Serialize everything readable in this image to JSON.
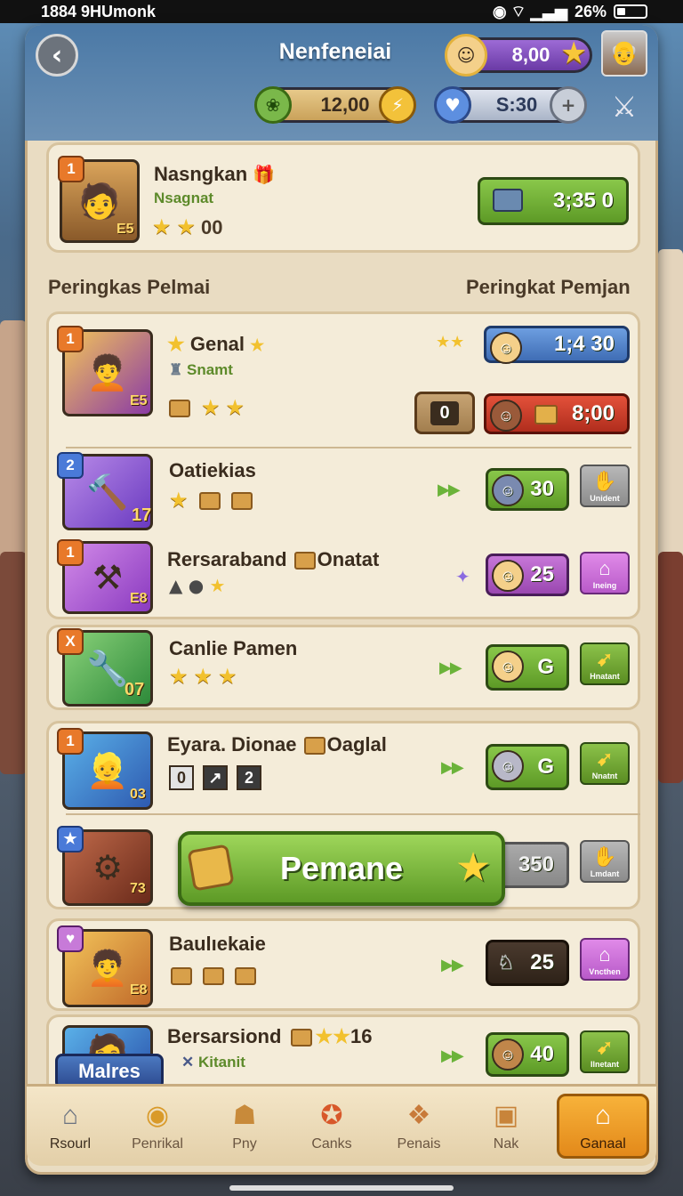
{
  "status": {
    "time": "1884 9HUmonk",
    "battery": "26%"
  },
  "header": {
    "title": "Nenfeneiai",
    "gems": "8,00",
    "coins": "12,00",
    "tickets": "S:30"
  },
  "top_card": {
    "rank": "1",
    "name": "Nasngkan",
    "sub": "Nsagnat",
    "level": "E5",
    "stars_count": "00",
    "reward": "3;35 0"
  },
  "sections": {
    "left": "Peringkas Pelmai",
    "right": "Peringkat Pemjan"
  },
  "rows": [
    {
      "rank": "1",
      "name": "Genal",
      "sub": "Snamt",
      "level": "E5",
      "reward_top": "1;4 30",
      "reward_mid_left": "0",
      "reward_bottom": "8;00"
    },
    {
      "rank": "2",
      "name": "Oatiekias",
      "level": "17",
      "reward": "30",
      "btn": "Unident"
    },
    {
      "rank": "1",
      "name": "Rersaraband",
      "extra": "Onatat",
      "level": "E8",
      "reward": "25",
      "btn": "Ineing"
    },
    {
      "rank": "X",
      "name": "Canlie Pamen",
      "level": "07",
      "reward": "G",
      "btn": "Hnatant"
    },
    {
      "rank": "1",
      "name": "Eyara. Dionae",
      "extra": "Oaglal",
      "level": "03",
      "boxes": [
        "0",
        "↗",
        "2"
      ],
      "reward": "G",
      "btn": "Nnatnt"
    },
    {
      "level": "73",
      "reward": "350",
      "btn": "Lmdant"
    },
    {
      "name": "Baulıekaie",
      "level": "E8",
      "reward": "25",
      "btn": "Vncthen"
    },
    {
      "name": "Bersarsiond",
      "extra_num": "16",
      "sub": "Kitanit",
      "reward": "40",
      "btn": "Ilnetant"
    }
  ],
  "main_button": "Pemane",
  "floating_label": "Malres",
  "tabs": [
    {
      "label": "Rsourl",
      "icon": "house-icon"
    },
    {
      "label": "Penrikal",
      "icon": "coin-icon"
    },
    {
      "label": "Pny",
      "icon": "bag-icon"
    },
    {
      "label": "Canks",
      "icon": "wrench-icon"
    },
    {
      "label": "Penais",
      "icon": "scroll-icon"
    },
    {
      "label": "Nak",
      "icon": "chest-icon"
    },
    {
      "label": "Ganaal",
      "icon": "home-up-icon"
    }
  ],
  "colors": {
    "accent_green": "#6fae32",
    "frame": "#e9dcc2",
    "gold": "#f2c12e"
  }
}
